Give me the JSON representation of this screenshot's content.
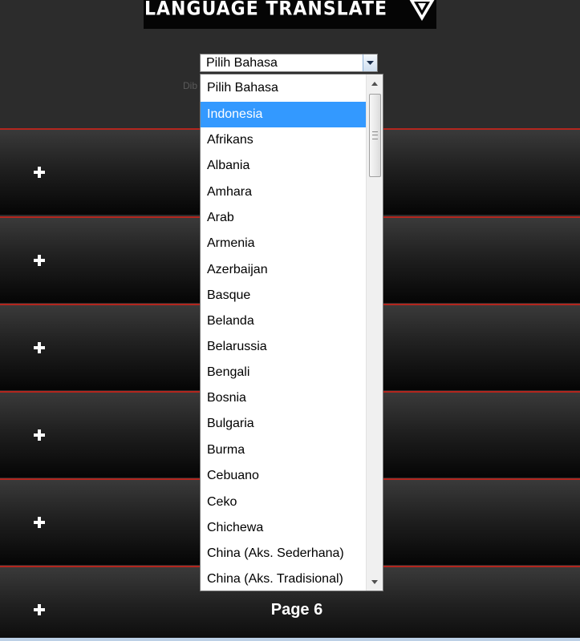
{
  "header": {
    "logo_text": "LANGUAGE TRANSLATE",
    "logo_icon": "triangle-logo-icon"
  },
  "select": {
    "current_value": "Pilih Bahasa",
    "arrow_icon": "chevron-down-icon"
  },
  "hint_text": "Dib                                                                        an",
  "dropdown": {
    "options": [
      {
        "label": "Pilih Bahasa",
        "selected": false
      },
      {
        "label": "Indonesia",
        "selected": true
      },
      {
        "label": "Afrikans",
        "selected": false
      },
      {
        "label": "Albania",
        "selected": false
      },
      {
        "label": "Amhara",
        "selected": false
      },
      {
        "label": "Arab",
        "selected": false
      },
      {
        "label": "Armenia",
        "selected": false
      },
      {
        "label": "Azerbaijan",
        "selected": false
      },
      {
        "label": "Basque",
        "selected": false
      },
      {
        "label": "Belanda",
        "selected": false
      },
      {
        "label": "Belarussia",
        "selected": false
      },
      {
        "label": "Bengali",
        "selected": false
      },
      {
        "label": "Bosnia",
        "selected": false
      },
      {
        "label": "Bulgaria",
        "selected": false
      },
      {
        "label": "Burma",
        "selected": false
      },
      {
        "label": "Cebuano",
        "selected": false
      },
      {
        "label": "Ceko",
        "selected": false
      },
      {
        "label": "Chichewa",
        "selected": false
      },
      {
        "label": "China (Aks. Sederhana)",
        "selected": false
      },
      {
        "label": "China (Aks. Tradisional)",
        "selected": false
      }
    ],
    "highlight_color": "#3399ff"
  },
  "rows": [
    {
      "label": ""
    },
    {
      "label": ""
    },
    {
      "label": ""
    },
    {
      "label": ""
    },
    {
      "label": ""
    },
    {
      "label": "Page 6"
    }
  ],
  "colors": {
    "row_border": "#b3261e",
    "page_background": "#2c2c2c"
  }
}
